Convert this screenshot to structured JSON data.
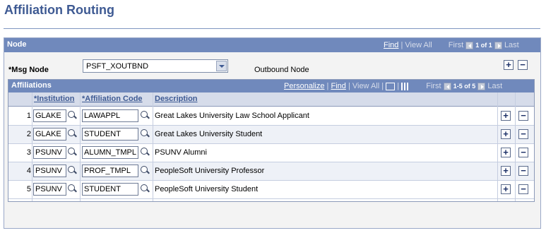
{
  "page": {
    "title": "Affiliation Routing"
  },
  "node_section": {
    "header": "Node",
    "find": "Find",
    "sep1": "|",
    "view_all": "View All",
    "first": "First",
    "counter": "1 of 1",
    "last": "Last",
    "msg_node_label": "*Msg Node",
    "msg_node_value": "PSFT_XOUTBND",
    "msg_node_desc": "Outbound Node",
    "add_label": "+",
    "remove_label": "−"
  },
  "affiliations": {
    "header": "Affiliations",
    "personalize": "Personalize",
    "sep": "|",
    "find": "Find",
    "view_all": "View All",
    "first": "First",
    "counter": "1-5 of 5",
    "last": "Last",
    "columns": {
      "institution": "*Institution",
      "affiliation_code": "*Affiliation Code",
      "description": "Description"
    },
    "rows": [
      {
        "num": "1",
        "institution": "GLAKE",
        "code": "LAWAPPL",
        "description": "Great Lakes University Law School Applicant"
      },
      {
        "num": "2",
        "institution": "GLAKE",
        "code": "STUDENT",
        "description": "Great Lakes University Student"
      },
      {
        "num": "3",
        "institution": "PSUNV",
        "code": "ALUMN_TMPL",
        "description": "PSUNV Alumni"
      },
      {
        "num": "4",
        "institution": "PSUNV",
        "code": "PROF_TMPL",
        "description": "PeopleSoft University Professor"
      },
      {
        "num": "5",
        "institution": "PSUNV",
        "code": "STUDENT",
        "description": "PeopleSoft University Student"
      }
    ]
  },
  "icons": {
    "lookup": "magnifier-icon",
    "add": "plus-icon",
    "remove": "minus-icon",
    "download": "download-icon",
    "grid": "grid-icon",
    "prev": "arrow-left-icon",
    "next": "arrow-right-icon"
  },
  "colors": {
    "title": "#3e5a93",
    "header_bg": "#7089bc",
    "column_bg": "#d6dcea"
  }
}
